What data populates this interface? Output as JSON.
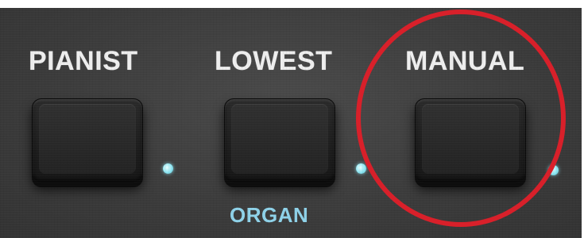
{
  "buttons": [
    {
      "label": "PIANIST",
      "sublabel": ""
    },
    {
      "label": "LOWEST",
      "sublabel": "ORGAN"
    },
    {
      "label": "MANUAL",
      "sublabel": ""
    }
  ],
  "colors": {
    "panel": "#3b3b3b",
    "label": "#eeeeee",
    "led": "#8ee6f2",
    "sublabel": "#8fd3ea",
    "highlight": "#d8202a"
  },
  "highlighted_button": "MANUAL"
}
